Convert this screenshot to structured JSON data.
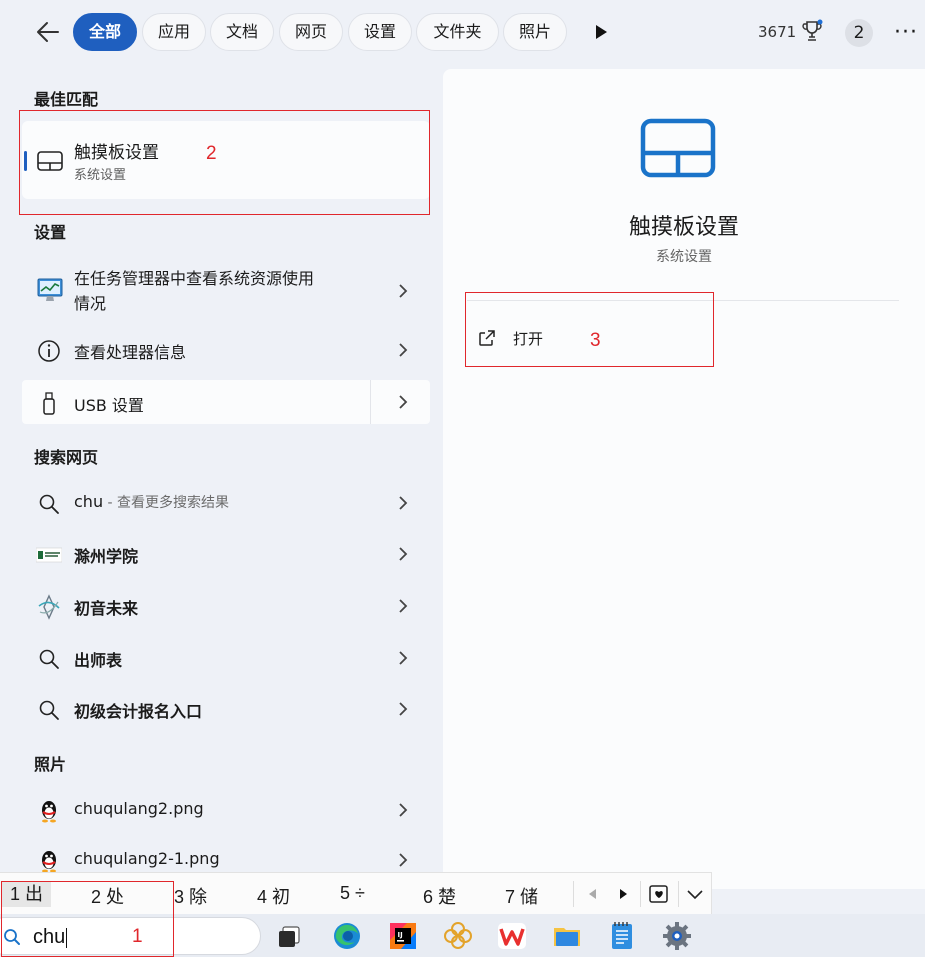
{
  "filters": {
    "tabs": [
      "全部",
      "应用",
      "文档",
      "网页",
      "设置",
      "文件夹",
      "照片"
    ],
    "active_index": 0
  },
  "header": {
    "points": "3671",
    "badge_count": "2"
  },
  "best_match": {
    "heading": "最佳匹配",
    "title": "触摸板设置",
    "subtitle": "系统设置"
  },
  "settings": {
    "heading": "设置",
    "items": [
      {
        "label_line1": "在任务管理器中查看系统资源使用",
        "label_line2": "情况"
      },
      {
        "label": "查看处理器信息"
      },
      {
        "label": "USB 设置"
      }
    ]
  },
  "web": {
    "heading": "搜索网页",
    "first": {
      "query": "chu",
      "suffix": " - 查看更多搜索结果"
    },
    "items": [
      "滁州学院",
      "初音未来",
      "出师表",
      "初级会计报名入口"
    ]
  },
  "photos": {
    "heading": "照片",
    "items": [
      "chuqulang2.png",
      "chuqulang2-1.png"
    ]
  },
  "detail": {
    "title": "触摸板设置",
    "subtitle": "系统设置",
    "open_label": "打开"
  },
  "ime": {
    "candidates": [
      "1 出",
      "2 处",
      "3 除",
      "4 初",
      "5 ÷",
      "6 楚",
      "7 储"
    ],
    "selected_index": 0
  },
  "search": {
    "value": "chu"
  },
  "annotations": [
    "1",
    "2",
    "3"
  ],
  "colors": {
    "accent": "#1f5fbf",
    "annotation": "#e0272c",
    "touchpad_icon": "#1a73c9"
  }
}
